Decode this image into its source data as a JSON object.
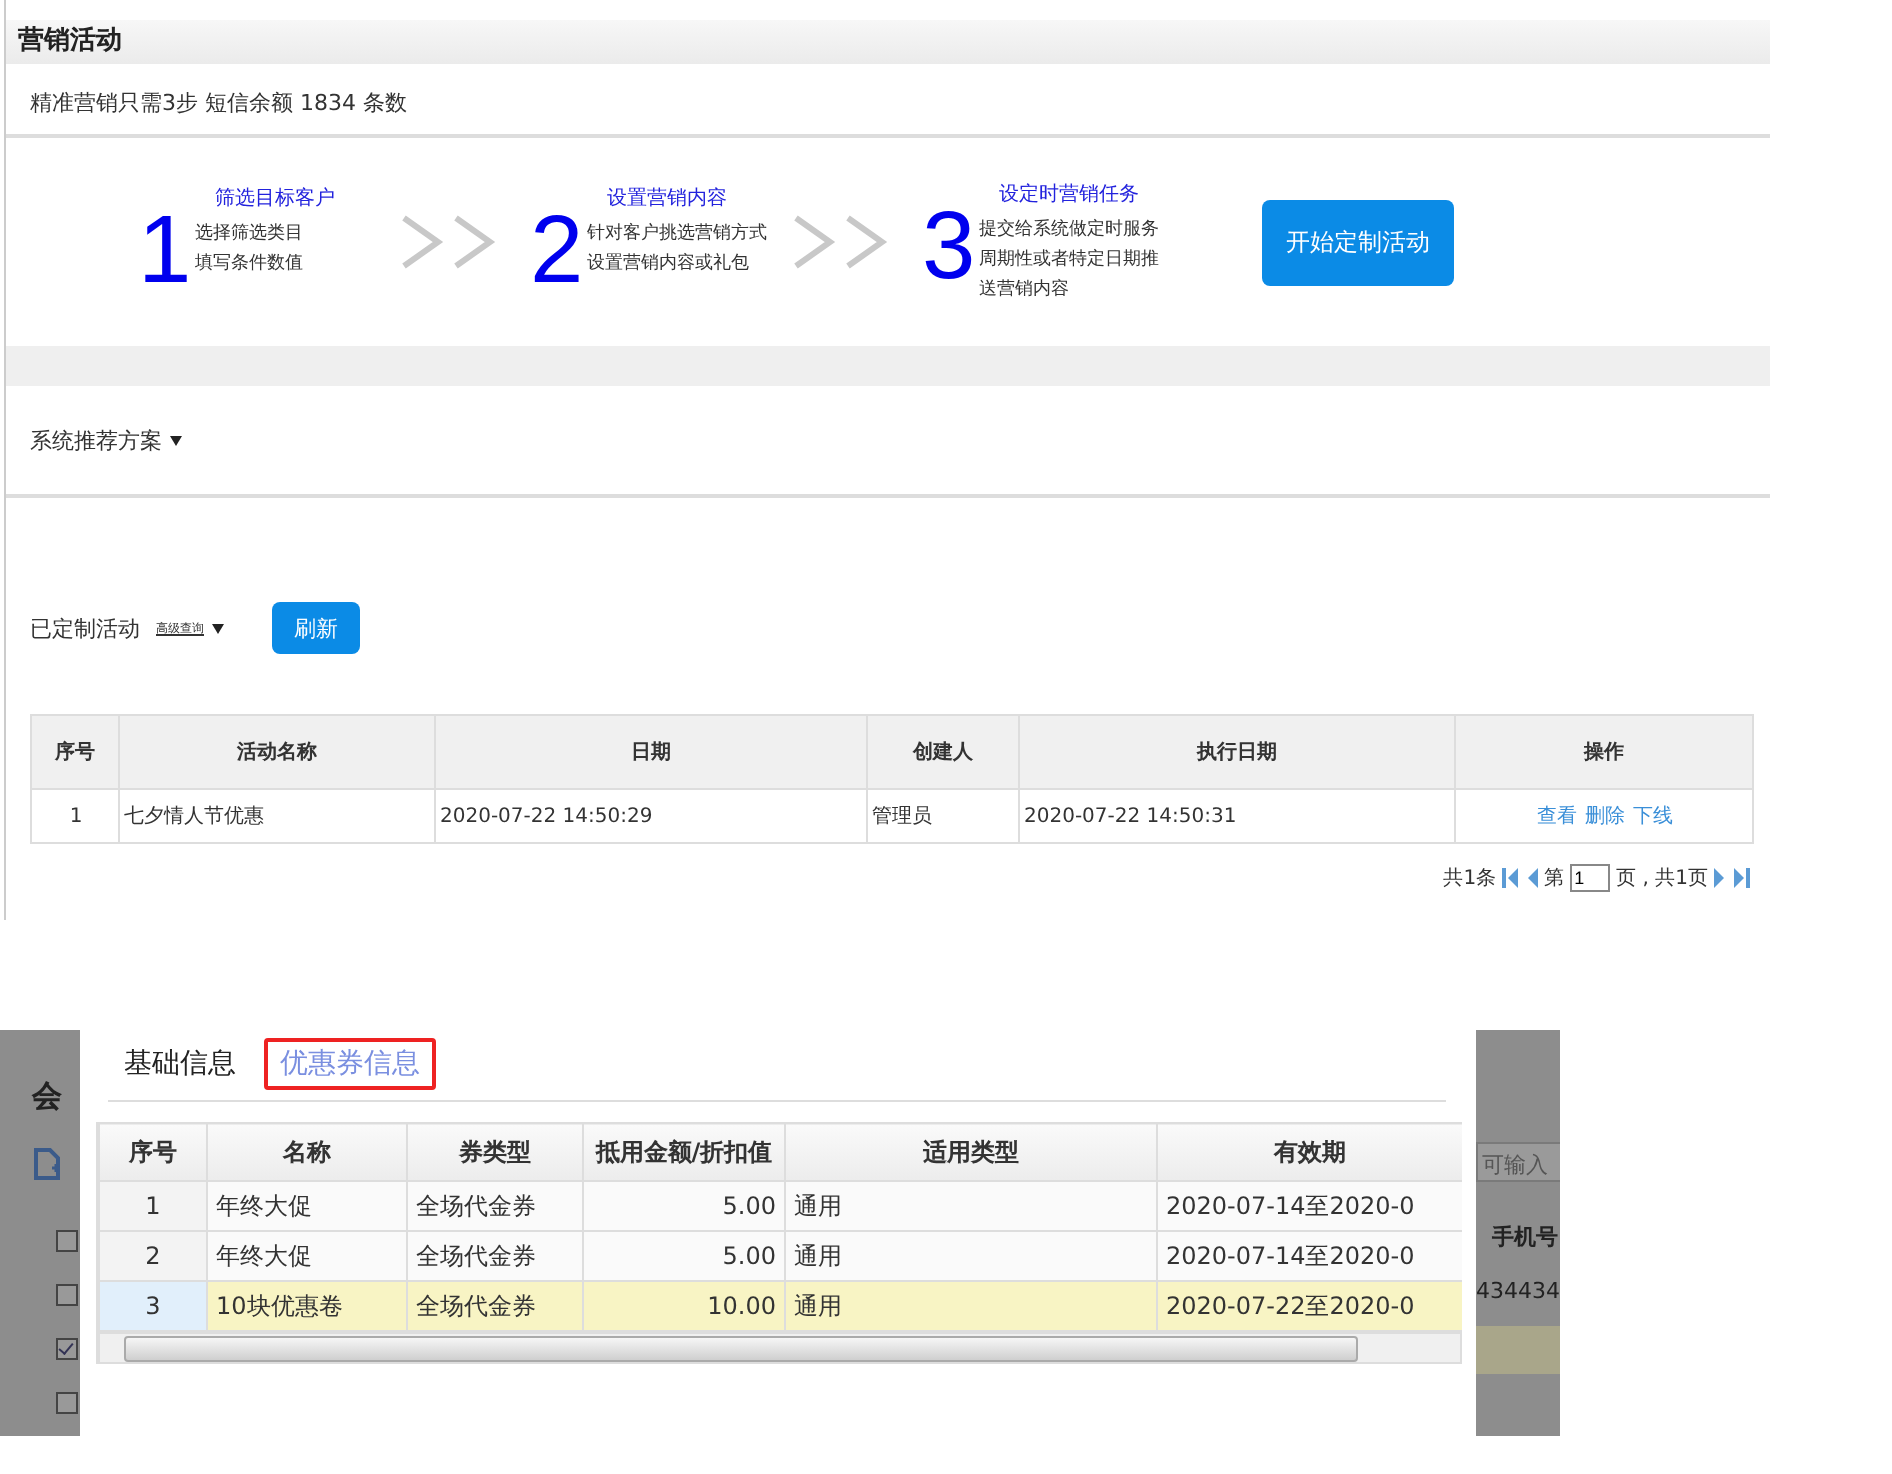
{
  "page": {
    "title": "营销活动",
    "summary": "精准营销只需3步  短信余额 1834 条数"
  },
  "steps": [
    {
      "number": "1",
      "title": "筛选目标客户",
      "lines": [
        "选择筛选类目",
        "填写条件数值"
      ]
    },
    {
      "number": "2",
      "title": "设置营销内容",
      "lines": [
        "针对客户挑选营销方式",
        "设置营销内容或礼包"
      ]
    },
    {
      "number": "3",
      "title": "设定时营销任务",
      "lines": [
        "提交给系统做定时服务",
        "周期性或者特定日期推送营销内容"
      ]
    }
  ],
  "start_button": "开始定制活动",
  "recommend": {
    "label": "系统推荐方案"
  },
  "custom": {
    "label": "已定制活动",
    "link": "高级查询",
    "refresh_button": "刷新"
  },
  "table": {
    "columns": [
      "序号",
      "活动名称",
      "日期",
      "创建人",
      "执行日期",
      "操作"
    ],
    "rows": [
      {
        "cells": [
          "1",
          "七夕情人节优惠",
          "2020-07-22 14:50:29",
          "管理员",
          "2020-07-22 14:50:31"
        ],
        "actions": [
          "查看",
          "删除",
          "下线"
        ]
      }
    ]
  },
  "pagination": {
    "total": "共1条",
    "page_prefix": "第",
    "page": "1",
    "page_suffix": "页 , 共1页"
  },
  "background_left": {
    "heading": "会",
    "checkboxes": [
      {
        "checked": false
      },
      {
        "checked": false
      },
      {
        "checked": true
      },
      {
        "checked": false
      }
    ]
  },
  "background_right": {
    "search_placeholder": "可输入",
    "column_header": "手机号",
    "cell": "434434"
  },
  "dialog": {
    "tabs": [
      {
        "label": "基础信息",
        "selected": false
      },
      {
        "label": "优惠券信息",
        "selected": true
      }
    ],
    "columns": [
      "序号",
      "名称",
      "券类型",
      "抵用金额/折扣值",
      "适用类型",
      "有效期"
    ],
    "rows": [
      {
        "cells": [
          "1",
          "年终大促",
          "全场代金券",
          "5.00",
          "通用",
          "2020-07-14至2020-0"
        ],
        "selected": false
      },
      {
        "cells": [
          "2",
          "年终大促",
          "全场代金券",
          "5.00",
          "通用",
          "2020-07-14至2020-0"
        ],
        "selected": false
      },
      {
        "cells": [
          "3",
          "10块优惠卷",
          "全场代金券",
          "10.00",
          "通用",
          "2020-07-22至2020-0"
        ],
        "selected": true
      }
    ]
  }
}
